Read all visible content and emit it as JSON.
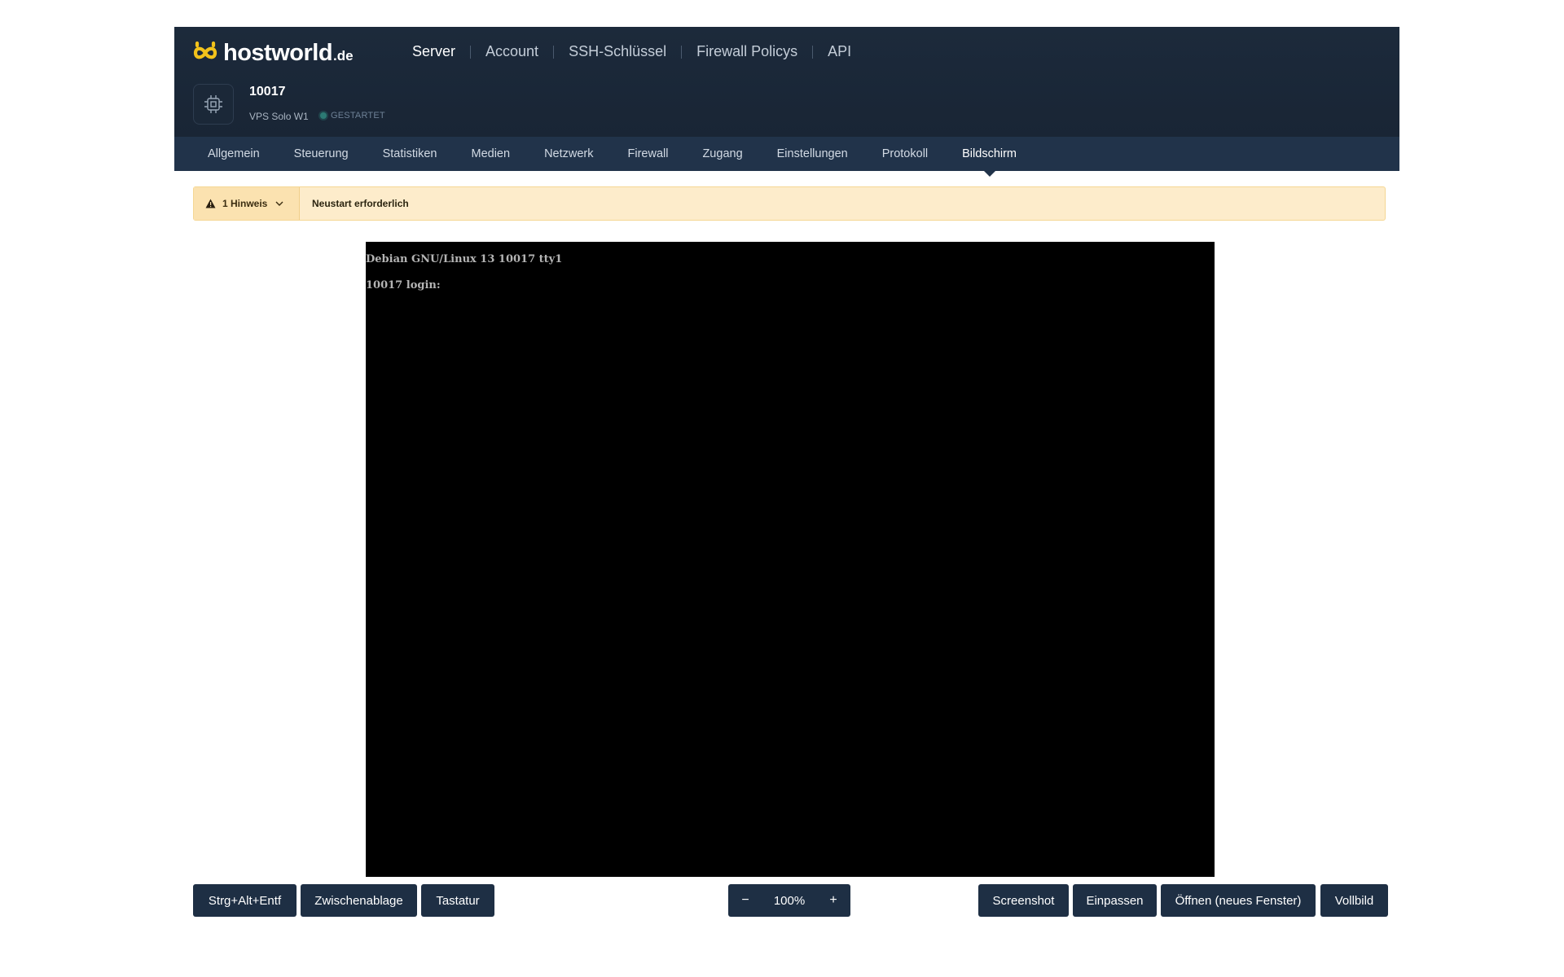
{
  "brand": {
    "name": "hostworld",
    "tld": ".de",
    "accent": "#f2c21b"
  },
  "topnav": [
    {
      "label": "Server",
      "active": true
    },
    {
      "label": "Account"
    },
    {
      "label": "SSH-Schlüssel"
    },
    {
      "label": "Firewall Policys"
    },
    {
      "label": "API"
    }
  ],
  "server": {
    "icon": "cpu-chip-icon",
    "name": "10017",
    "plan": "VPS Solo W1",
    "status": "GESTARTET"
  },
  "tabs": [
    {
      "label": "Allgemein"
    },
    {
      "label": "Steuerung"
    },
    {
      "label": "Statistiken"
    },
    {
      "label": "Medien"
    },
    {
      "label": "Netzwerk"
    },
    {
      "label": "Firewall"
    },
    {
      "label": "Zugang"
    },
    {
      "label": "Einstellungen"
    },
    {
      "label": "Protokoll"
    },
    {
      "label": "Bildschirm",
      "active": true
    }
  ],
  "notice": {
    "toggle_label": "1 Hinweis",
    "message": "Neustart erforderlich"
  },
  "console": {
    "lines": [
      "Debian GNU/Linux 13 10017 tty1",
      "10017 login:"
    ]
  },
  "toolbar": {
    "ctrl_alt_del": "Strg+Alt+Entf",
    "clipboard": "Zwischenablage",
    "keyboard": "Tastatur",
    "zoom_minus": "−",
    "zoom_value": "100%",
    "zoom_plus": "+",
    "screenshot": "Screenshot",
    "fit": "Einpassen",
    "open_new_window": "Öffnen (neues Fenster)",
    "fullscreen": "Vollbild"
  }
}
